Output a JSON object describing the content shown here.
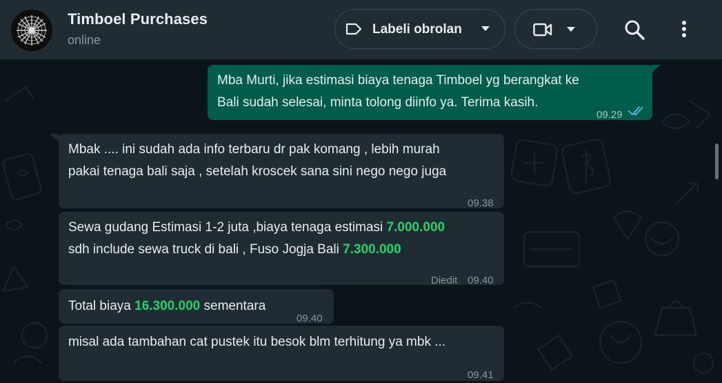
{
  "header": {
    "name": "Timboel Purchases",
    "status": "online",
    "label_button": "Labeli obrolan"
  },
  "icons": {
    "label": "label-tag-icon",
    "chevron": "chevron-down-icon",
    "video": "video-camera-icon",
    "search": "search-icon",
    "menu": "kebab-menu-icon",
    "read": "double-check-icon"
  },
  "colors": {
    "header": "#202c33",
    "chat_bg": "#0b141a",
    "incoming": "#202c33",
    "outgoing": "#005c4b",
    "highlight": "#25d366",
    "read_tick": "#53bdeb"
  },
  "messages": [
    {
      "direction": "out",
      "lines": [
        "Mba Murti, jika estimasi biaya tenaga Timboel yg berangkat ke",
        "Bali sudah selesai, minta tolong diinfo ya. Terima kasih."
      ],
      "time": "09.29"
    },
    {
      "direction": "in",
      "lines": [
        "Mbak .... ini sudah ada info terbaru dr pak komang , lebih murah",
        "pakai tenaga bali saja , setelah kroscek sana sini nego nego juga"
      ],
      "time": "09.38"
    },
    {
      "direction": "in",
      "line1_text": "Sewa gudang Estimasi 1-2 juta ,biaya tenaga estimasi ",
      "line1_amount": "7.000.000",
      "line2_text": "sdh include sewa truck di bali , Fuso Jogja Bali ",
      "line2_amount": "7.300.000",
      "edited": "Diedit",
      "time": "09.40"
    },
    {
      "direction": "in",
      "prefix": "Total biaya ",
      "amount": "16.300.000",
      "suffix": " sementara",
      "time": "09.40"
    },
    {
      "direction": "in",
      "lines": [
        "misal ada tambahan cat pustek itu besok blm terhitung ya mbk ..."
      ],
      "time": "09.41"
    }
  ]
}
